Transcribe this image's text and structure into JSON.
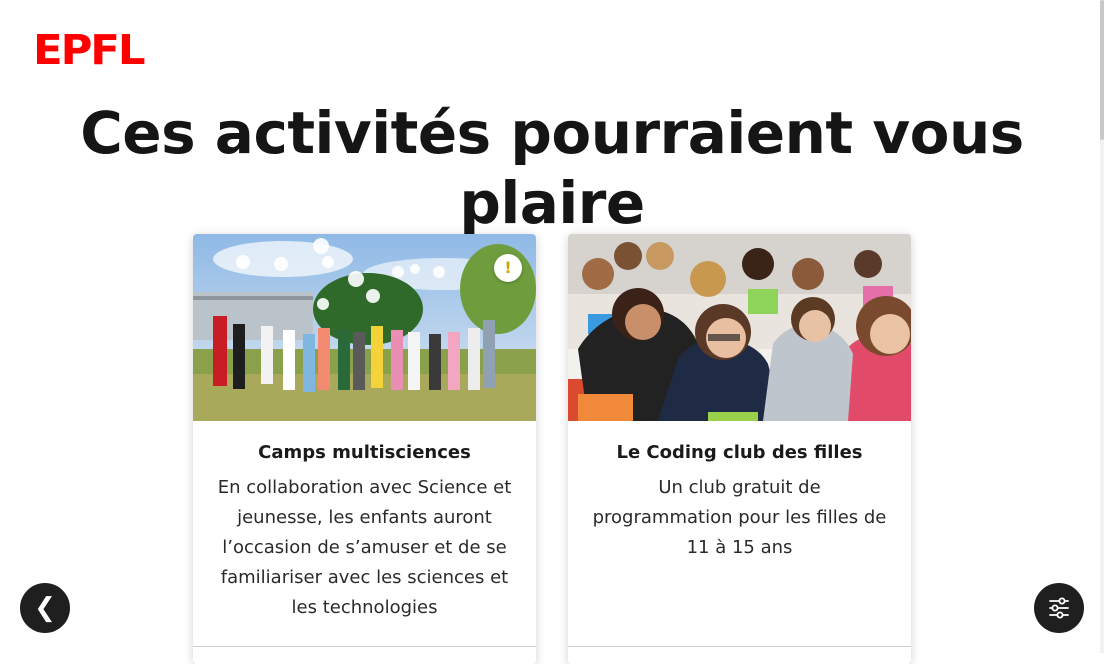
{
  "header": {
    "logo_text": "EPFL",
    "page_title": "Ces activités pourraient vous plaire"
  },
  "cards": [
    {
      "title": "Camps multisciences",
      "description": "En collaboration avec Science et jeunesse, les enfants auront l’occasion de s’amuser et de se familiariser avec les sciences et les technologies",
      "image": "photo-children-throwing-paper-outdoors",
      "badge": "!"
    },
    {
      "title": "Le Coding club des filles",
      "description": "Un club gratuit de programmation pour les filles de 11 à 15 ans",
      "image": "photo-girls-in-classroom-with-laptops"
    }
  ],
  "controls": {
    "prev_glyph": "❮",
    "filter_icon": "sliders-icon"
  },
  "colors": {
    "brand": "#ff0000",
    "button_bg": "#1f1f1f",
    "badge": "#c8a700"
  }
}
